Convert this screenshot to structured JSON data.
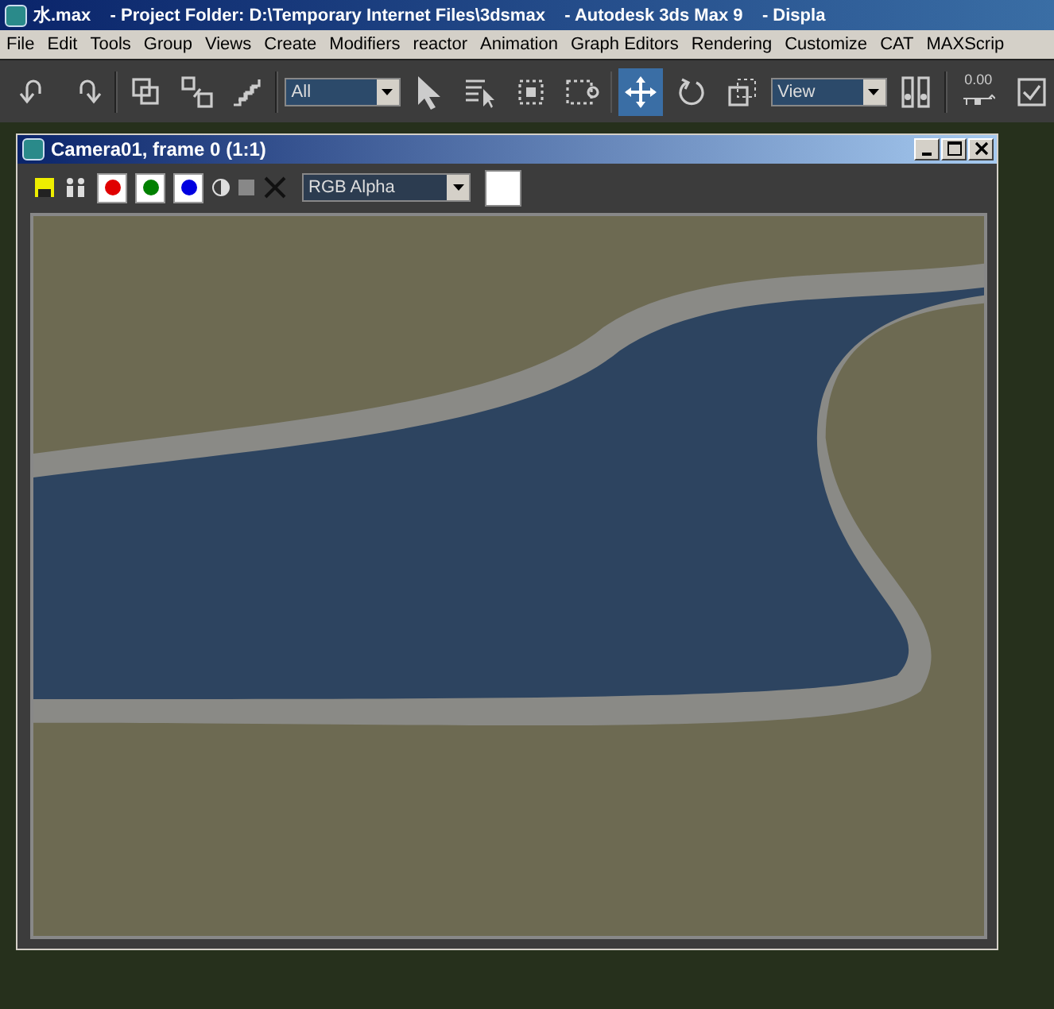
{
  "window": {
    "title": "水.max    - Project Folder: D:\\Temporary Internet Files\\3dsmax    - Autodesk 3ds Max 9    - Displa"
  },
  "menu": [
    "File",
    "Edit",
    "Tools",
    "Group",
    "Views",
    "Create",
    "Modifiers",
    "reactor",
    "Animation",
    "Graph Editors",
    "Rendering",
    "Customize",
    "CAT",
    "MAXScrip"
  ],
  "toolbar": [
    {
      "kind": "undo",
      "selected": false
    },
    {
      "kind": "redo",
      "selected": false
    },
    {
      "kind": "sep"
    },
    {
      "kind": "link",
      "selected": false
    },
    {
      "kind": "unlink",
      "selected": false
    },
    {
      "kind": "bind",
      "selected": false
    },
    {
      "kind": "sep"
    },
    {
      "kind": "dropdown",
      "value": "All"
    },
    {
      "kind": "select",
      "selected": false
    },
    {
      "kind": "select-name",
      "selected": false
    },
    {
      "kind": "region",
      "selected": false
    },
    {
      "kind": "window",
      "selected": false
    },
    {
      "kind": "sep"
    },
    {
      "kind": "move",
      "selected": true
    },
    {
      "kind": "rotate",
      "selected": false
    },
    {
      "kind": "scale",
      "selected": false
    },
    {
      "kind": "dropdown",
      "value": "View"
    },
    {
      "kind": "pivot",
      "selected": false
    },
    {
      "kind": "sep"
    },
    {
      "kind": "snap",
      "text": "0.00"
    },
    {
      "kind": "check",
      "selected": false
    }
  ],
  "render_window": {
    "title": "Camera01, frame 0 (1:1)",
    "tools": [
      {
        "kind": "save"
      },
      {
        "kind": "clone"
      },
      {
        "kind": "channel",
        "color": "#e00000",
        "on": true
      },
      {
        "kind": "channel",
        "color": "#008000",
        "on": true
      },
      {
        "kind": "channel",
        "color": "#0000e0",
        "on": true
      },
      {
        "kind": "mono"
      },
      {
        "kind": "clear"
      },
      {
        "kind": "cross"
      },
      {
        "kind": "dropdown",
        "value": "RGB Alpha"
      },
      {
        "kind": "swatch",
        "color": "#ffffff"
      }
    ]
  }
}
